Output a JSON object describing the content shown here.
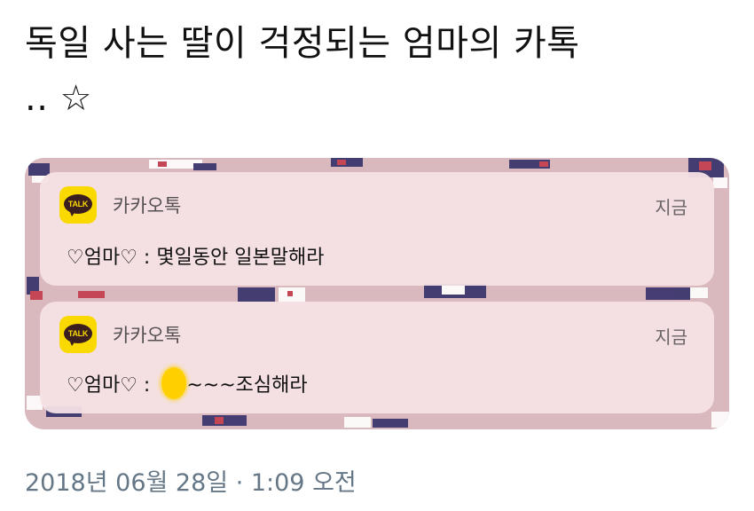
{
  "tweet": {
    "title_line1": "독일 사는 딸이 걱정되는 엄마의 카톡",
    "title_line2": ".. ☆",
    "date": "2018년 06월 28일 · 1:09 오전"
  },
  "notifications": [
    {
      "app_name": "카카오톡",
      "icon_text": "TALK",
      "time": "지금",
      "message": "♡엄마♡ : 몇일동안 일본말해라"
    },
    {
      "app_name": "카카오톡",
      "icon_text": "TALK",
      "time": "지금",
      "message_prefix": "♡엄마♡ : ",
      "message_suffix": "~~~조심해라"
    }
  ],
  "colors": {
    "kakao_yellow": "#f9d900",
    "kakao_brown": "#3b1e1e",
    "notification_bg": "#f6e2e5",
    "wallpaper": "#d9b9bd",
    "date_gray": "#657786",
    "redaction_yellow": "#ffd000"
  },
  "icons": {
    "app_icon": "kakaotalk-icon"
  }
}
